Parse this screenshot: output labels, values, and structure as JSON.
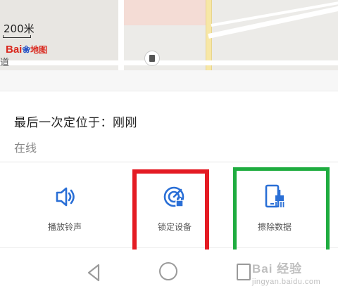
{
  "map": {
    "scale_label": "200米",
    "logo_text": "Bai",
    "logo_suffix": "地图",
    "road_label": "道"
  },
  "sheet": {
    "last_location_label": "最后一次定位于：刚刚",
    "status_text": "在线"
  },
  "actions": [
    {
      "label": "播放铃声",
      "icon": "speaker-icon"
    },
    {
      "label": "锁定设备",
      "icon": "lock-device-icon"
    },
    {
      "label": "擦除数据",
      "icon": "erase-data-icon"
    }
  ],
  "colors": {
    "accent": "#2a6fd6",
    "annotation_red": "#e41b23",
    "annotation_green": "#1eac3f"
  },
  "watermark": {
    "line1": "Bai 经验",
    "line2": "jingyan.baidu.com"
  }
}
